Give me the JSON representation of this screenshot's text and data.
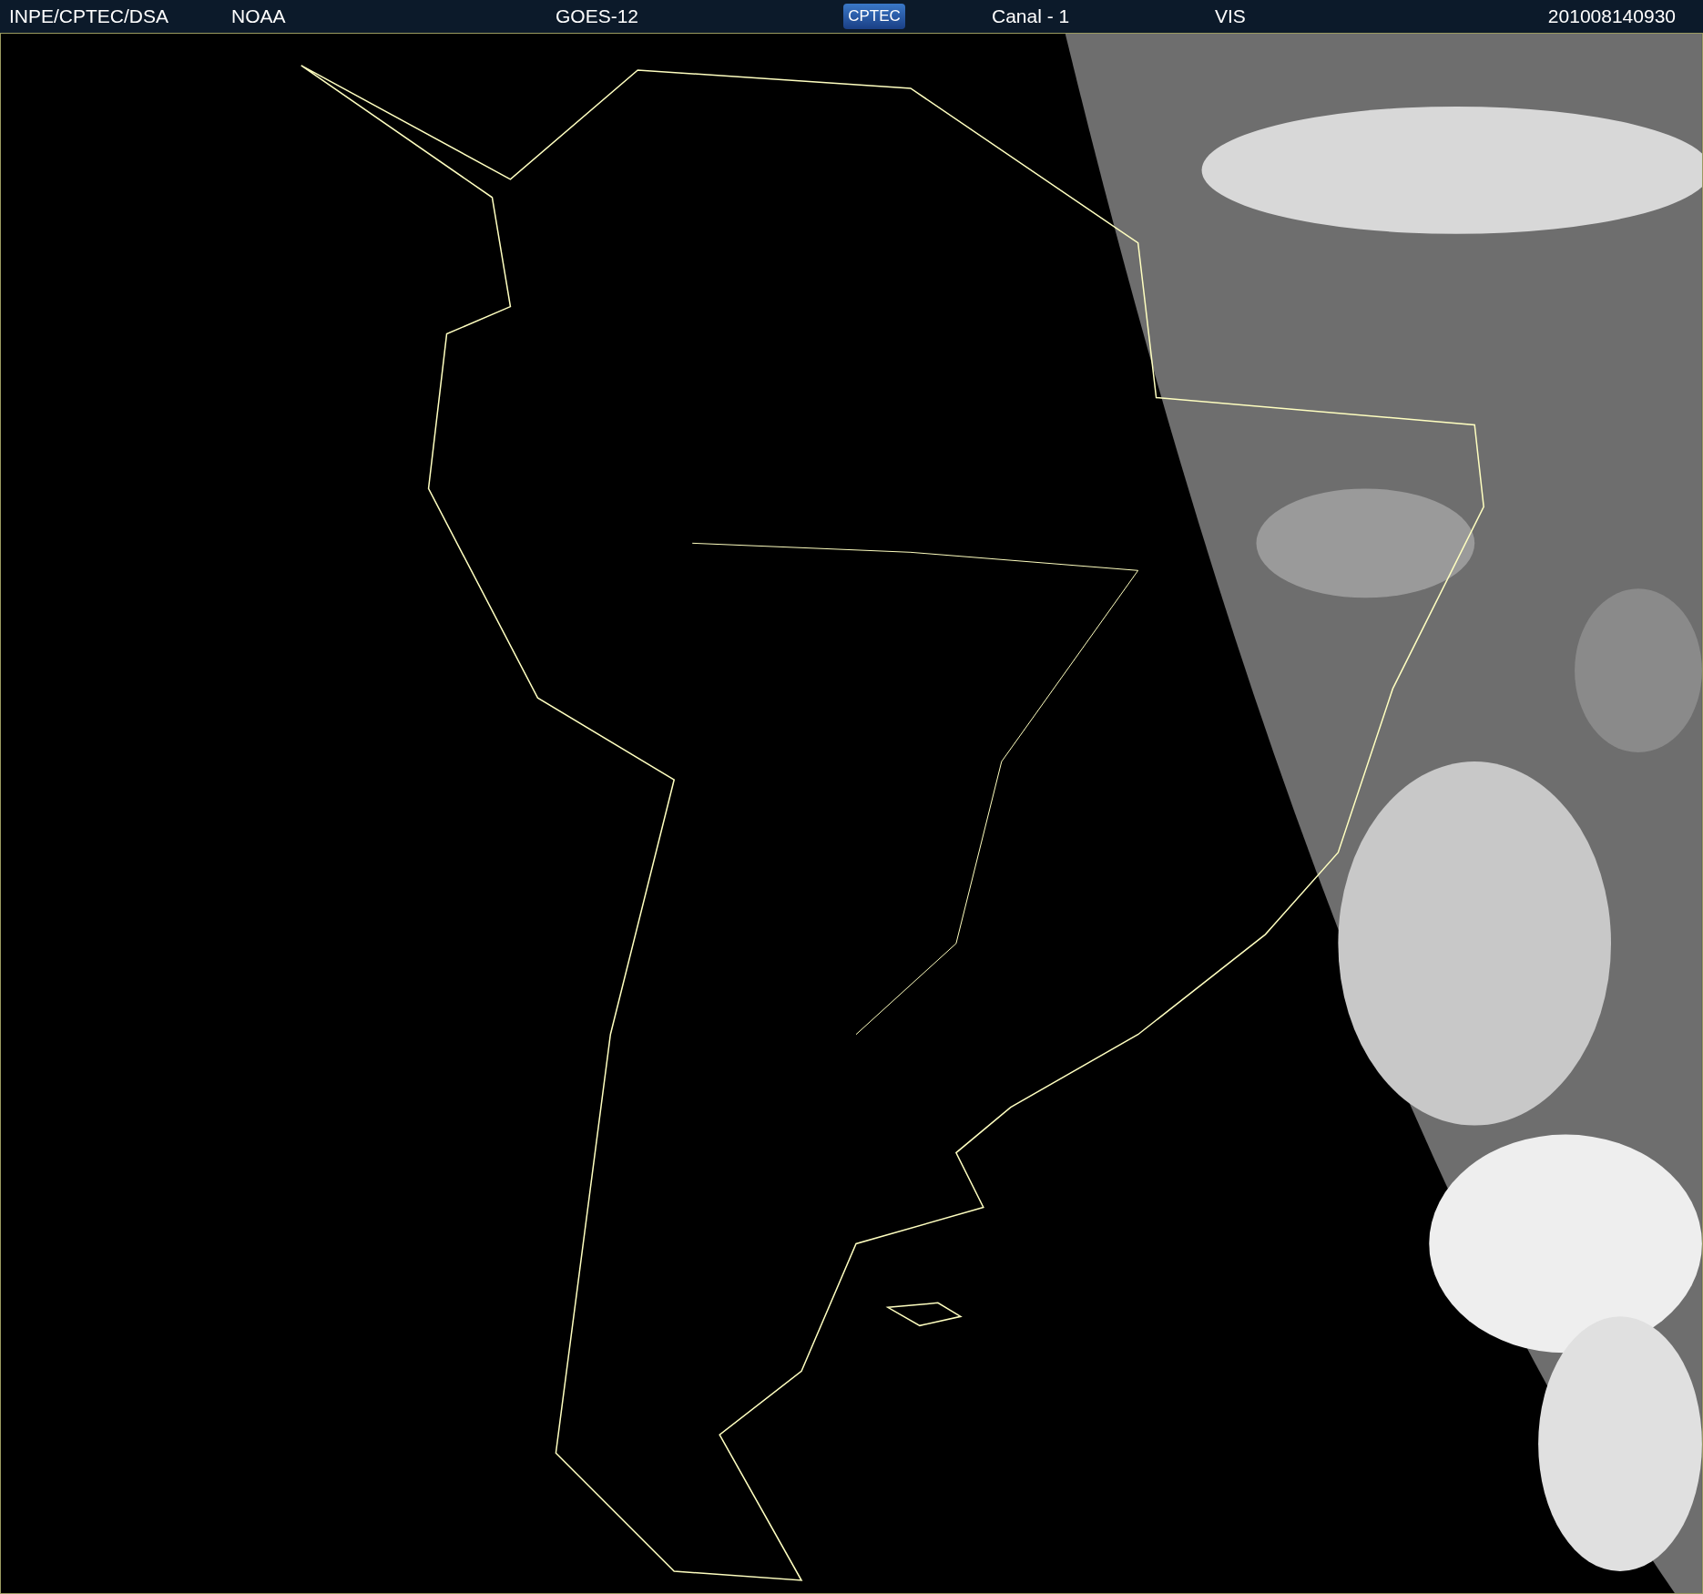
{
  "header": {
    "source": "INPE/CPTEC/DSA",
    "agency": "NOAA",
    "satellite": "GOES-12",
    "logo": "CPTEC",
    "channel": "Canal - 1",
    "band": "VIS",
    "timestamp": "201008140930"
  }
}
